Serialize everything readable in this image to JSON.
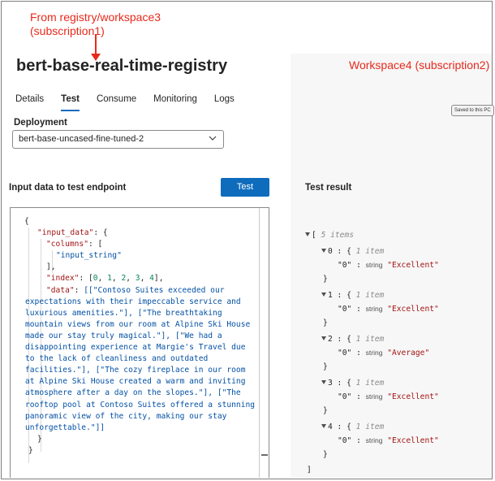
{
  "annotations": {
    "source": "From registry/workspace3 (subscription1)",
    "target": "Workspace4 (subscription2)"
  },
  "page": {
    "title": "bert-base-real-time-registry"
  },
  "tabs": [
    "Details",
    "Test",
    "Consume",
    "Monitoring",
    "Logs"
  ],
  "active_tab": "Test",
  "badge": "Saved to this PC",
  "deployment": {
    "label": "Deployment",
    "value": "bert-base-uncased-fine-tuned-2"
  },
  "input": {
    "title": "Input data to test endpoint",
    "test_button": "Test",
    "code": {
      "open": "{",
      "input_data_key": "\"input_data\"",
      "columns_key": "\"columns\"",
      "columns_value": "\"input_string\"",
      "index_key": "\"index\"",
      "index_values": [
        "0",
        "1",
        "2",
        "3",
        "4"
      ],
      "data_key": "\"data\"",
      "data_text": "[[\"Contoso Suites exceeded our expectations with their impeccable service and luxurious amenities.\"], [\"The breathtaking mountain views from our room at Alpine Ski House made our stay truly magical.\"], [\"We had a disappointing experience at Margie's Travel due to the lack of cleanliness and outdated facilities.\"], [\"The cozy fireplace in our room at Alpine Ski House created a warm and inviting atmosphere after a day on the slopes.\"], [\"The rooftop pool at Contoso Suites offered a stunning panoramic view of the city, making our stay unforgettable.\"]]"
    }
  },
  "result": {
    "title": "Test result",
    "count_label": "5 items",
    "item_meta": "1 item",
    "field_key": "\"0\"",
    "type_label": "string",
    "items": [
      {
        "index": "0",
        "value": "\"Excellent\""
      },
      {
        "index": "1",
        "value": "\"Excellent\""
      },
      {
        "index": "2",
        "value": "\"Average\""
      },
      {
        "index": "3",
        "value": "\"Excellent\""
      },
      {
        "index": "4",
        "value": "\"Excellent\""
      }
    ]
  }
}
